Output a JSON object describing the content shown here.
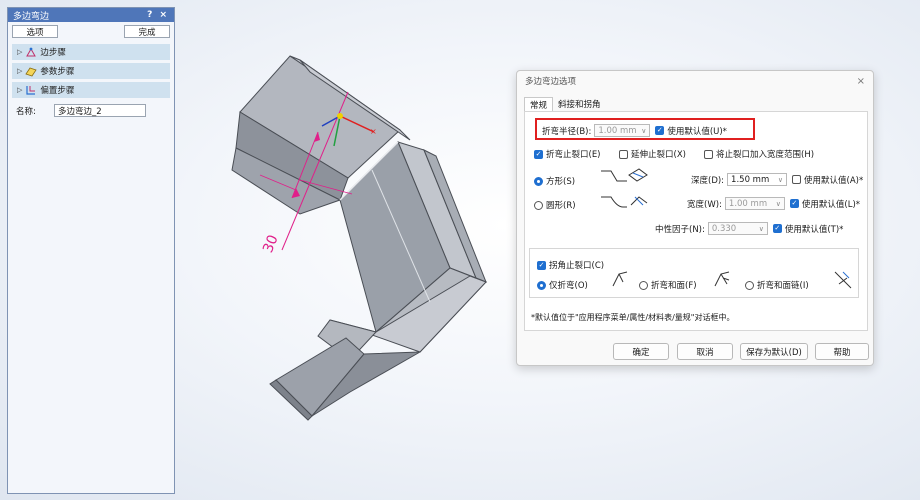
{
  "panel": {
    "title": "多边弯边",
    "controls": "? ×",
    "options_button": "选项",
    "finish_button": "完成",
    "steps": [
      {
        "label": "边步骤",
        "icon": "edge-step-icon"
      },
      {
        "label": "参数步骤",
        "icon": "parameter-step-icon"
      },
      {
        "label": "偏置步骤",
        "icon": "offset-step-icon"
      }
    ],
    "name_label": "名称:",
    "name_value": "多边弯边_2"
  },
  "viewport": {
    "dimension_label": "30"
  },
  "dialog": {
    "title": "多边弯边选项",
    "close": "×",
    "tabs": [
      {
        "label": "常规",
        "active": true
      },
      {
        "label": "斜接和拐角",
        "active": false
      }
    ],
    "bend_radius": {
      "label": "折弯半径(B):",
      "value": "1.00 mm",
      "use_default_label": "使用默认值(U)*",
      "use_default_checked": true
    },
    "bend_relief": {
      "label": "折弯止裂口(E)",
      "checked": true
    },
    "extend_relief": {
      "label": "延伸止裂口(X)",
      "checked": false
    },
    "add_relief_width": {
      "label": "将止裂口加入宽度范围(H)",
      "checked": false
    },
    "shape_square": {
      "label": "方形(S)",
      "selected": true
    },
    "shape_round": {
      "label": "圆形(R)",
      "selected": false
    },
    "depth": {
      "label": "深度(D):",
      "value": "1.50 mm",
      "use_default_label": "使用默认值(A)*",
      "use_default_checked": false
    },
    "width": {
      "label": "宽度(W):",
      "value": "1.00 mm",
      "use_default_label": "使用默认值(L)*",
      "use_default_checked": true
    },
    "neutral_factor": {
      "label": "中性因子(N):",
      "value": "0.330",
      "use_default_label": "使用默认值(T)*",
      "use_default_checked": true
    },
    "corner_relief": {
      "label": "拐角止裂口(C)",
      "checked": true,
      "options": [
        {
          "label": "仅折弯(O)",
          "selected": true
        },
        {
          "label": "折弯和面(F)",
          "selected": false
        },
        {
          "label": "折弯和面链(I)",
          "selected": false
        }
      ]
    },
    "note": "*默认值位于\"应用程序菜单/属性/材料表/量规\"对话框中。",
    "buttons": {
      "ok": "确定",
      "cancel": "取消",
      "save_default": "保存为默认(D)",
      "help": "帮助"
    }
  },
  "colors": {
    "accent": "#1f6fd0",
    "highlight": "#e02020",
    "panel_title": "#4f76b9",
    "step_bg": "#cfe1ef",
    "dimension": "#e0208a"
  }
}
